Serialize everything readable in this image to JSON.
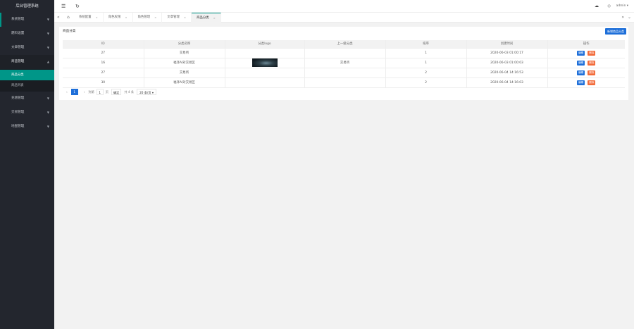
{
  "sidebar": {
    "brand": "后台管理系统",
    "items": [
      {
        "label": "系统管理",
        "arrow": "▼"
      },
      {
        "label": "題料设置",
        "arrow": "▼"
      },
      {
        "label": "文章管理",
        "arrow": "▼"
      },
      {
        "label": "商品管理",
        "arrow": "▲"
      },
      {
        "label": "充值管理",
        "arrow": "▼"
      },
      {
        "label": "交易管理",
        "arrow": "▼"
      },
      {
        "label": "地图管理",
        "arrow": "▼"
      }
    ],
    "sub_items": [
      {
        "label": "商品分类"
      },
      {
        "label": "商品列表"
      }
    ]
  },
  "header": {
    "menu_icon": "☰",
    "refresh_icon": "↻",
    "cloud_icon": "☁",
    "tag_icon": "◇",
    "user": "admin ▾"
  },
  "tabbar": {
    "prev": "«",
    "home_icon": "⌂",
    "next": "»",
    "more": "⌄",
    "tabs": [
      {
        "label": "系统配置",
        "close": "×"
      },
      {
        "label": "角色权限",
        "close": "×"
      },
      {
        "label": "角色管理",
        "close": "×"
      },
      {
        "label": "文章管理",
        "close": "×"
      },
      {
        "label": "商品分类",
        "close": "×"
      }
    ]
  },
  "card": {
    "title": "商品分类",
    "add_button": "新增商品分类"
  },
  "table": {
    "headers": [
      "ID",
      "分类名称",
      "分类logo",
      "上一级分类",
      "排序",
      "创建时间",
      "操作"
    ],
    "rows": [
      {
        "id": "27",
        "name": "交易所",
        "parent": "",
        "sort": "1",
        "created": "2020-06-03 01:00:17"
      },
      {
        "id": "16",
        "name": "福泽AI对交易区",
        "parent": "交易所",
        "sort": "1",
        "created": "2020-06-03 01:00:03"
      },
      {
        "id": "27",
        "name": "交易所",
        "parent": "",
        "sort": "2",
        "created": "2020-06-04 14:16:53"
      },
      {
        "id": "30",
        "name": "福泽AI对交易区",
        "parent": "",
        "sort": "2",
        "created": "2020-06-04 14:16:03"
      }
    ],
    "edit_label": "编辑",
    "delete_label": "删除"
  },
  "pager": {
    "prev": "‹",
    "current": "1",
    "next": "›",
    "to_label": "到第",
    "jump_value": "1",
    "page_label": "页",
    "go_label": "确定",
    "total": "共 4 条",
    "page_size": "20 条/页 ▾"
  }
}
